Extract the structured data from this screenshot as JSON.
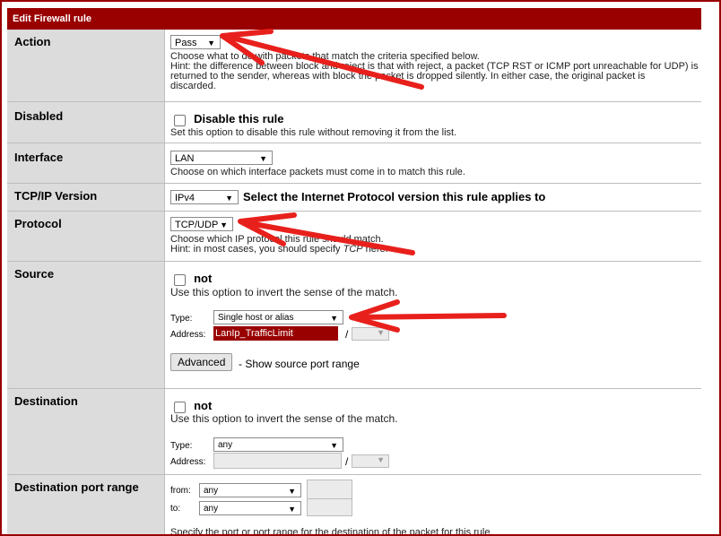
{
  "panel_title": "Edit Firewall rule",
  "action": {
    "label": "Action",
    "value": "Pass",
    "desc": "Choose what to do with packets that match the criteria specified below.",
    "hint1": "Hint: the difference between block and reject is that with reject, a packet (TCP RST or ICMP port unreachable for UDP) is",
    "hint2": "returned to the sender, whereas with block the packet is dropped silently. In either case, the original packet is",
    "hint3": "discarded."
  },
  "disabled": {
    "label": "Disabled",
    "checkbox_label": "Disable this rule",
    "hint": "Set this option to disable this rule without removing it from the list."
  },
  "interface": {
    "label": "Interface",
    "value": "LAN",
    "hint": "Choose on which interface packets must come in to match this rule."
  },
  "tcpip": {
    "label": "TCP/IP Version",
    "value": "IPv4",
    "note": "Select the Internet Protocol version this rule applies to"
  },
  "protocol": {
    "label": "Protocol",
    "value": "TCP/UDP",
    "hint1": "Choose which IP protocol this rule should match.",
    "hint2_prefix": "Hint: in most cases, you should specify ",
    "hint2_em": "TCP",
    "hint2_suffix": " here."
  },
  "source": {
    "label": "Source",
    "not_label": "not",
    "not_hint": "Use this option to invert the sense of the match.",
    "type_label": "Type:",
    "type_value": "Single host or alias",
    "address_label": "Address:",
    "address_value": "LanIp_TrafficLimit",
    "slash": "/",
    "advanced_button": "Advanced",
    "advanced_text": "- Show source port range"
  },
  "destination": {
    "label": "Destination",
    "not_label": "not",
    "not_hint": "Use this option to invert the sense of the match.",
    "type_label": "Type:",
    "type_value": "any",
    "address_label": "Address:",
    "slash": "/"
  },
  "dest_port": {
    "label": "Destination port range",
    "from_label": "from:",
    "from_value": "any",
    "to_label": "to:",
    "to_value": "any",
    "hint": "Specify the port or port range for the destination of the packet for this rule."
  },
  "colors": {
    "header_bg": "#990000",
    "label_bg": "#dcdcdc",
    "arrow": "#e8201c",
    "address_bg": "#990000"
  }
}
